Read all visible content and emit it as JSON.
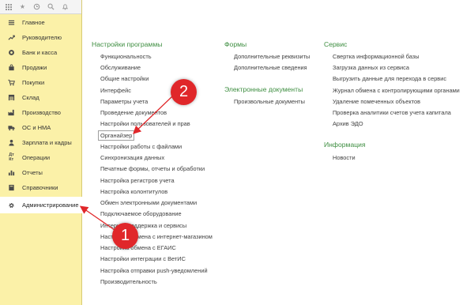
{
  "sidebar": {
    "items": [
      {
        "label": "Главное",
        "icon": "menu-icon"
      },
      {
        "label": "Руководителю",
        "icon": "trend-icon"
      },
      {
        "label": "Банк и касса",
        "icon": "coins-icon"
      },
      {
        "label": "Продажи",
        "icon": "bag-icon"
      },
      {
        "label": "Покупки",
        "icon": "cart-icon"
      },
      {
        "label": "Склад",
        "icon": "warehouse-icon"
      },
      {
        "label": "Производство",
        "icon": "factory-icon"
      },
      {
        "label": "ОС и НМА",
        "icon": "truck-icon"
      },
      {
        "label": "Зарплата и кадры",
        "icon": "person-icon"
      },
      {
        "label": "Операции",
        "icon": "dt-kt-icon"
      },
      {
        "label": "Отчеты",
        "icon": "chart-icon"
      },
      {
        "label": "Справочники",
        "icon": "book-icon"
      },
      {
        "label": "Администрирование",
        "icon": "gear-icon"
      }
    ]
  },
  "sections": {
    "settings": {
      "title": "Настройки программы",
      "links": [
        "Функциональность",
        "Обслуживание",
        "Общие настройки",
        "Интерфейс",
        "Параметры учета",
        "Проведение документов",
        "Настройки пользователей и прав",
        "Органайзер",
        "Настройки работы с файлами",
        "Синхронизация данных",
        "Печатные формы, отчеты и обработки",
        "Настройка регистров учета",
        "Настройка колонтитулов",
        "Обмен электронными документами",
        "Подключаемое оборудование",
        "Интернет-поддержка и сервисы",
        "Настройка обмена с интернет-магазином",
        "Настройка обмена с ЕГАИС",
        "Настройки интеграции с ВетИС",
        "Настройка отправки push-уведомлений",
        "Производительность"
      ]
    },
    "forms": {
      "title": "Формы",
      "links": [
        "Дополнительные реквизиты",
        "Дополнительные сведения"
      ]
    },
    "edocs": {
      "title": "Электронные документы",
      "links": [
        "Произвольные документы"
      ]
    },
    "service": {
      "title": "Сервис",
      "links": [
        "Свертка информационной базы",
        "Загрузка данных из сервиса",
        "Выгрузить данные для перехода в сервис",
        "Журнал обмена с контролирующими органами",
        "Удаление помеченных объектов",
        "Проверка аналитики счетов учета капитала",
        "Архив ЭДО"
      ]
    },
    "info": {
      "title": "Информация",
      "links": [
        "Новости"
      ]
    }
  },
  "annotations": {
    "badge1": "1",
    "badge2": "2",
    "color": "#e0272a"
  }
}
